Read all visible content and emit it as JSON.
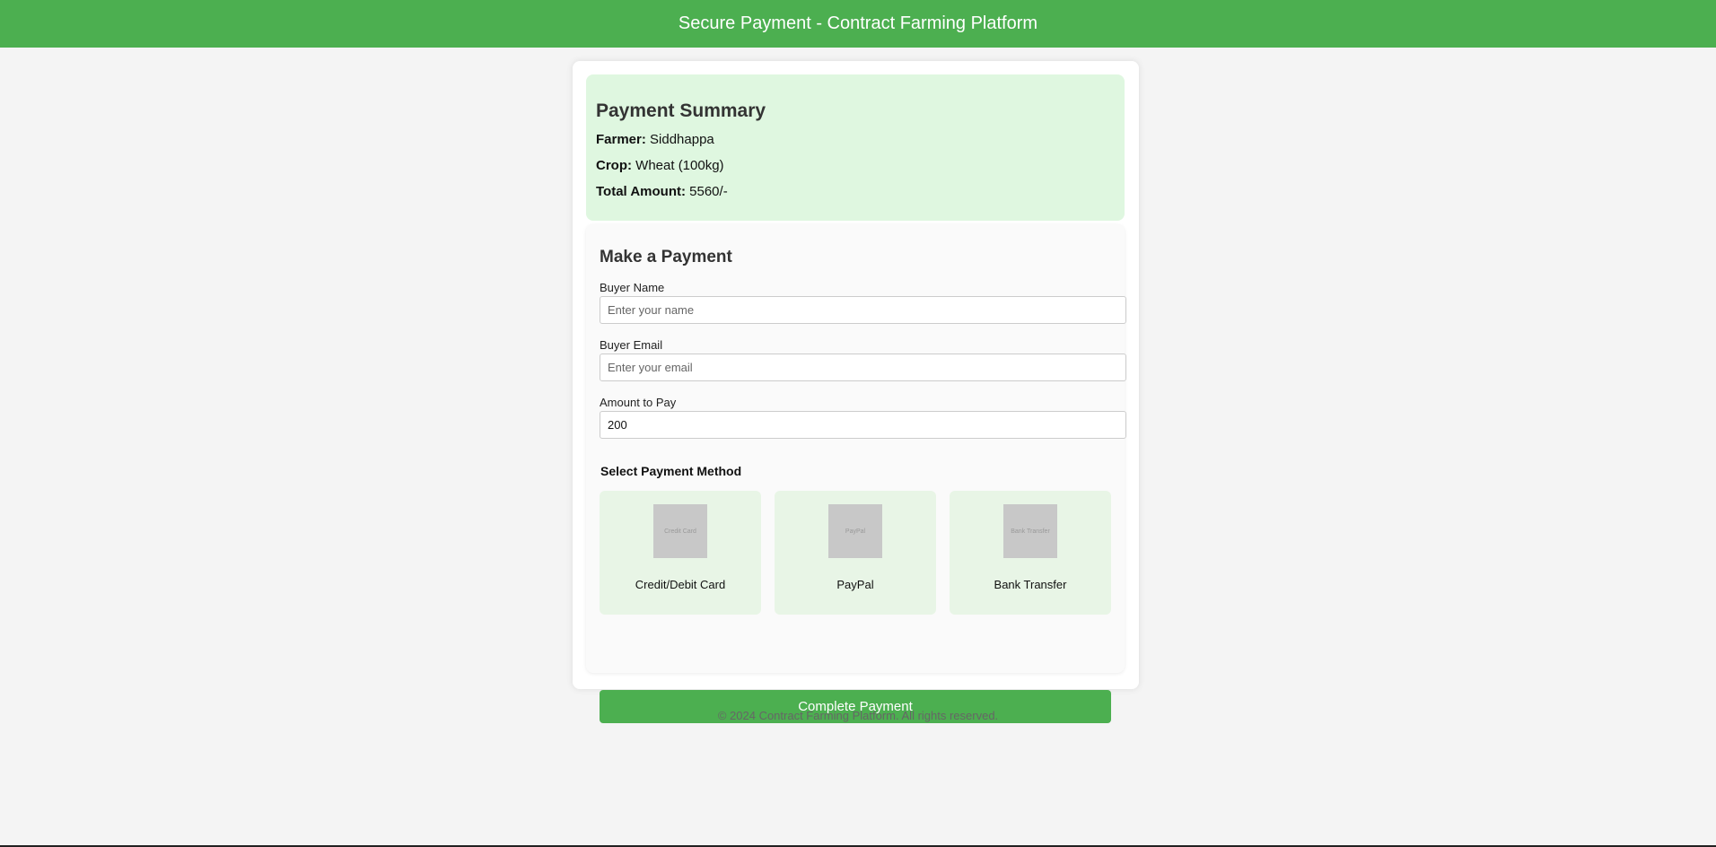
{
  "header": {
    "title": "Secure Payment - Contract Farming Platform"
  },
  "summary": {
    "heading": "Payment Summary",
    "farmer_label": "Farmer:",
    "farmer_value": "Siddhappa",
    "crop_label": "Crop:",
    "crop_value": "Wheat (100kg)",
    "total_label": "Total Amount:",
    "total_value": "5560/-"
  },
  "form": {
    "heading": "Make a Payment",
    "buyer_name_label": "Buyer Name",
    "buyer_name_placeholder": "Enter your name",
    "buyer_name_value": "",
    "buyer_email_label": "Buyer Email",
    "buyer_email_placeholder": "Enter your email",
    "buyer_email_value": "",
    "amount_label": "Amount to Pay",
    "amount_value": "200"
  },
  "methods": {
    "title": "Select Payment Method",
    "items": [
      {
        "thumb_text": "Credit Card",
        "label": "Credit/Debit Card",
        "icon": "credit-card-icon"
      },
      {
        "thumb_text": "PayPal",
        "label": "PayPal",
        "icon": "paypal-icon"
      },
      {
        "thumb_text": "Bank Transfer",
        "label": "Bank Transfer",
        "icon": "bank-transfer-icon"
      }
    ]
  },
  "actions": {
    "complete_label": "Complete Payment"
  },
  "footer": {
    "text": "© 2024 Contract Farming Platform. All rights reserved."
  },
  "colors": {
    "brand": "#4caf50",
    "summary_bg": "#dff7e0",
    "method_bg": "#e8f5e6"
  }
}
